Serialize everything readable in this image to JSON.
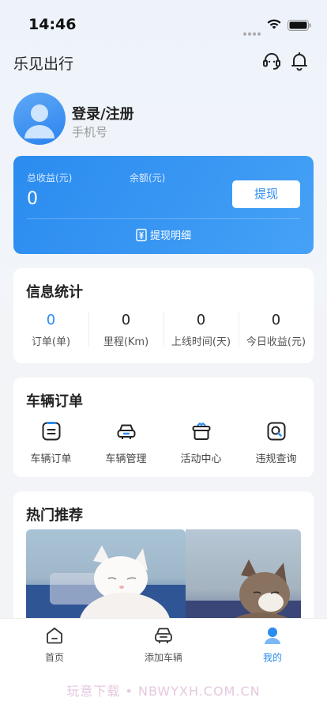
{
  "status_bar": {
    "time": "14:46"
  },
  "header": {
    "title": "乐见出行"
  },
  "profile": {
    "login_label": "登录/注册",
    "phone_label": "手机号"
  },
  "earnings": {
    "total_label": "总收益(元)",
    "total_value": "0",
    "balance_label": "余额(元)",
    "withdraw_button": "提现",
    "withdraw_detail": "提现明细"
  },
  "stats": {
    "title": "信息统计",
    "items": [
      {
        "value": "0",
        "label": "订单(单)"
      },
      {
        "value": "0",
        "label": "里程(Km)"
      },
      {
        "value": "0",
        "label": "上线时间(天)"
      },
      {
        "value": "0",
        "label": "今日收益(元)"
      }
    ]
  },
  "vehicle_orders": {
    "title": "车辆订单",
    "items": [
      {
        "label": "车辆订单",
        "icon": "order-list-icon"
      },
      {
        "label": "车辆管理",
        "icon": "car-icon"
      },
      {
        "label": "活动中心",
        "icon": "gift-basket-icon"
      },
      {
        "label": "违规查询",
        "icon": "search-doc-icon"
      }
    ]
  },
  "hot": {
    "title": "热门推荐"
  },
  "tab_bar": {
    "items": [
      {
        "label": "首页",
        "icon": "home-icon"
      },
      {
        "label": "添加车辆",
        "icon": "add-car-icon"
      },
      {
        "label": "我的",
        "icon": "profile-icon",
        "active": true
      }
    ]
  },
  "watermark": "玩意下载 • NBWYXH.COM.CN",
  "colors": {
    "accent": "#2b8cf0"
  }
}
